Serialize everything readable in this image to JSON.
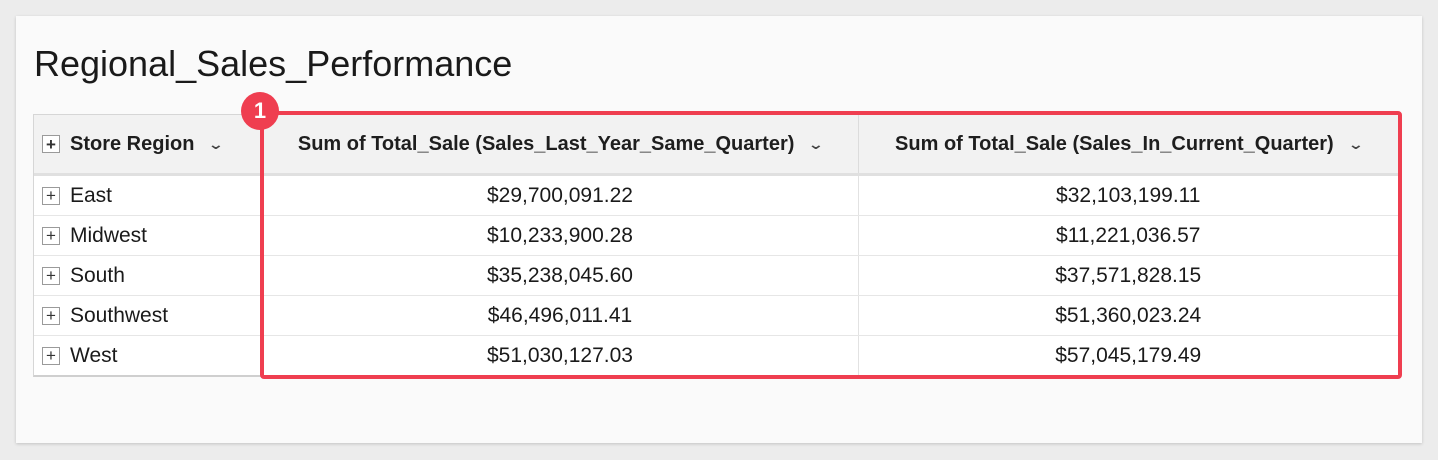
{
  "page_title": "Regional_Sales_Performance",
  "table": {
    "columns": [
      {
        "label": "Store Region"
      },
      {
        "label": "Sum of Total_Sale (Sales_Last_Year_Same_Quarter)"
      },
      {
        "label": "Sum of Total_Sale (Sales_In_Current_Quarter)"
      }
    ],
    "rows": [
      {
        "region": "East",
        "last_year": "$29,700,091.22",
        "current": "$32,103,199.11"
      },
      {
        "region": "Midwest",
        "last_year": "$10,233,900.28",
        "current": "$11,221,036.57"
      },
      {
        "region": "South",
        "last_year": "$35,238,045.60",
        "current": "$37,571,828.15"
      },
      {
        "region": "Southwest",
        "last_year": "$46,496,011.41",
        "current": "$51,360,023.24"
      },
      {
        "region": "West",
        "last_year": "$51,030,127.03",
        "current": "$57,045,179.49"
      }
    ]
  },
  "annotation": {
    "badge_number": "1",
    "color": "#ef3e50"
  },
  "icons": {
    "expand": "plus-icon",
    "dropdown": "chevron-down-icon"
  }
}
